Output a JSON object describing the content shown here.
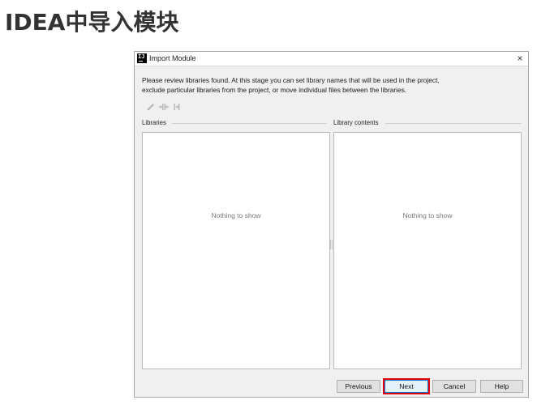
{
  "page": {
    "heading": "IDEA中导入模块"
  },
  "dialog": {
    "title": "Import Module",
    "app_icon_text": "IJ",
    "close_glyph": "×",
    "message_line1": "Please review libraries found. At this stage you can set library names that will be used in the project,",
    "message_line2": "exclude particular libraries from the project, or move individual files between the libraries.",
    "toolbar": {
      "icons": [
        "pencil-icon",
        "split-library-icon",
        "merge-library-icon"
      ],
      "enabled": false
    },
    "libraries": {
      "label": "Libraries",
      "empty_text": "Nothing to show"
    },
    "library_contents": {
      "label": "Library contents",
      "empty_text": "Nothing to show"
    },
    "buttons": {
      "previous": "Previous",
      "next": "Next",
      "cancel": "Cancel",
      "help": "Help"
    },
    "highlight_color": "#e60000"
  }
}
